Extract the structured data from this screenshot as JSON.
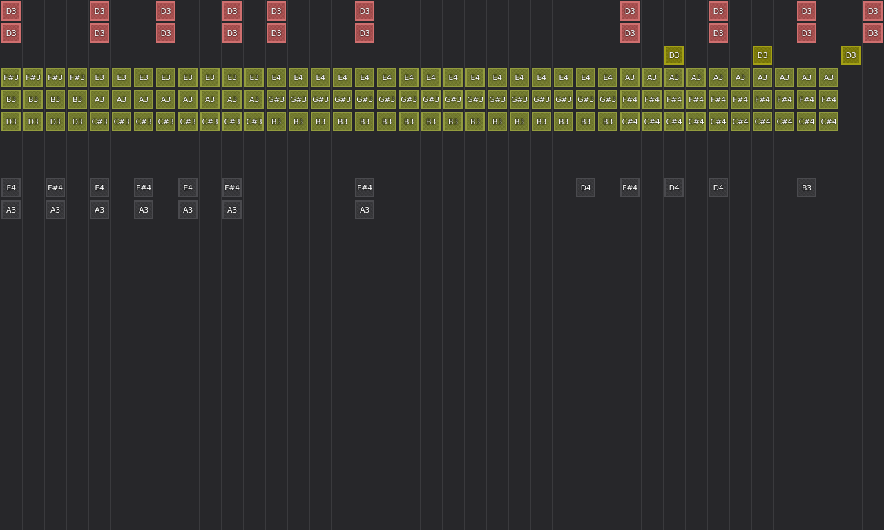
{
  "grid": {
    "columns": 40,
    "colors": {
      "background": "#27272a",
      "column_line": "#3a3a3d",
      "red": "#a84e4e",
      "green": "#727a2c",
      "olive": "#7c7a08",
      "gray": "#37373a"
    }
  },
  "rows": [
    {
      "row": 0,
      "color": "red",
      "notes": [
        {
          "col": 0,
          "label": "D3"
        },
        {
          "col": 4,
          "label": "D3"
        },
        {
          "col": 7,
          "label": "D3"
        },
        {
          "col": 10,
          "label": "D3"
        },
        {
          "col": 12,
          "label": "D3"
        },
        {
          "col": 16,
          "label": "D3"
        },
        {
          "col": 28,
          "label": "D3"
        },
        {
          "col": 32,
          "label": "D3"
        },
        {
          "col": 36,
          "label": "D3"
        },
        {
          "col": 39,
          "label": "D3"
        }
      ]
    },
    {
      "row": 1,
      "color": "red",
      "notes": [
        {
          "col": 0,
          "label": "D3"
        },
        {
          "col": 4,
          "label": "D3"
        },
        {
          "col": 7,
          "label": "D3"
        },
        {
          "col": 10,
          "label": "D3"
        },
        {
          "col": 12,
          "label": "D3"
        },
        {
          "col": 16,
          "label": "D3"
        },
        {
          "col": 28,
          "label": "D3"
        },
        {
          "col": 32,
          "label": "D3"
        },
        {
          "col": 36,
          "label": "D3"
        },
        {
          "col": 39,
          "label": "D3"
        }
      ]
    },
    {
      "row": 2,
      "color": "olive",
      "notes": [
        {
          "col": 30,
          "label": "D3"
        },
        {
          "col": 34,
          "label": "D3"
        },
        {
          "col": 38,
          "label": "D3"
        }
      ]
    },
    {
      "row": 3,
      "color": "green",
      "labels": [
        "F#3",
        "F#3",
        "F#3",
        "F#3",
        "E3",
        "E3",
        "E3",
        "E3",
        "E3",
        "E3",
        "E3",
        "E3",
        "E4",
        "E4",
        "E4",
        "E4",
        "E4",
        "E4",
        "E4",
        "E4",
        "E4",
        "E4",
        "E4",
        "E4",
        "E4",
        "E4",
        "E4",
        "E4",
        "A3",
        "A3",
        "A3",
        "A3",
        "A3",
        "A3",
        "A3",
        "A3",
        "A3",
        "A3"
      ]
    },
    {
      "row": 4,
      "color": "green",
      "labels": [
        "B3",
        "B3",
        "B3",
        "B3",
        "A3",
        "A3",
        "A3",
        "A3",
        "A3",
        "A3",
        "A3",
        "A3",
        "G#3",
        "G#3",
        "G#3",
        "G#3",
        "G#3",
        "G#3",
        "G#3",
        "G#3",
        "G#3",
        "G#3",
        "G#3",
        "G#3",
        "G#3",
        "G#3",
        "G#3",
        "G#3",
        "F#4",
        "F#4",
        "F#4",
        "F#4",
        "F#4",
        "F#4",
        "F#4",
        "F#4",
        "F#4",
        "F#4"
      ]
    },
    {
      "row": 5,
      "color": "green",
      "labels": [
        "D3",
        "D3",
        "D3",
        "D3",
        "C#3",
        "C#3",
        "C#3",
        "C#3",
        "C#3",
        "C#3",
        "C#3",
        "C#3",
        "B3",
        "B3",
        "B3",
        "B3",
        "B3",
        "B3",
        "B3",
        "B3",
        "B3",
        "B3",
        "B3",
        "B3",
        "B3",
        "B3",
        "B3",
        "B3",
        "C#4",
        "C#4",
        "C#4",
        "C#4",
        "C#4",
        "C#4",
        "C#4",
        "C#4",
        "C#4",
        "C#4"
      ]
    },
    {
      "row": 8,
      "color": "gray",
      "notes": [
        {
          "col": 0,
          "label": "E4"
        },
        {
          "col": 2,
          "label": "F#4"
        },
        {
          "col": 4,
          "label": "E4"
        },
        {
          "col": 6,
          "label": "F#4"
        },
        {
          "col": 8,
          "label": "E4"
        },
        {
          "col": 10,
          "label": "F#4"
        },
        {
          "col": 16,
          "label": "F#4"
        },
        {
          "col": 26,
          "label": "D4"
        },
        {
          "col": 28,
          "label": "F#4"
        },
        {
          "col": 30,
          "label": "D4"
        },
        {
          "col": 32,
          "label": "D4"
        },
        {
          "col": 36,
          "label": "B3"
        }
      ]
    },
    {
      "row": 9,
      "color": "gray",
      "notes": [
        {
          "col": 0,
          "label": "A3"
        },
        {
          "col": 2,
          "label": "A3"
        },
        {
          "col": 4,
          "label": "A3"
        },
        {
          "col": 6,
          "label": "A3"
        },
        {
          "col": 8,
          "label": "A3"
        },
        {
          "col": 10,
          "label": "A3"
        },
        {
          "col": 16,
          "label": "A3"
        }
      ]
    }
  ]
}
